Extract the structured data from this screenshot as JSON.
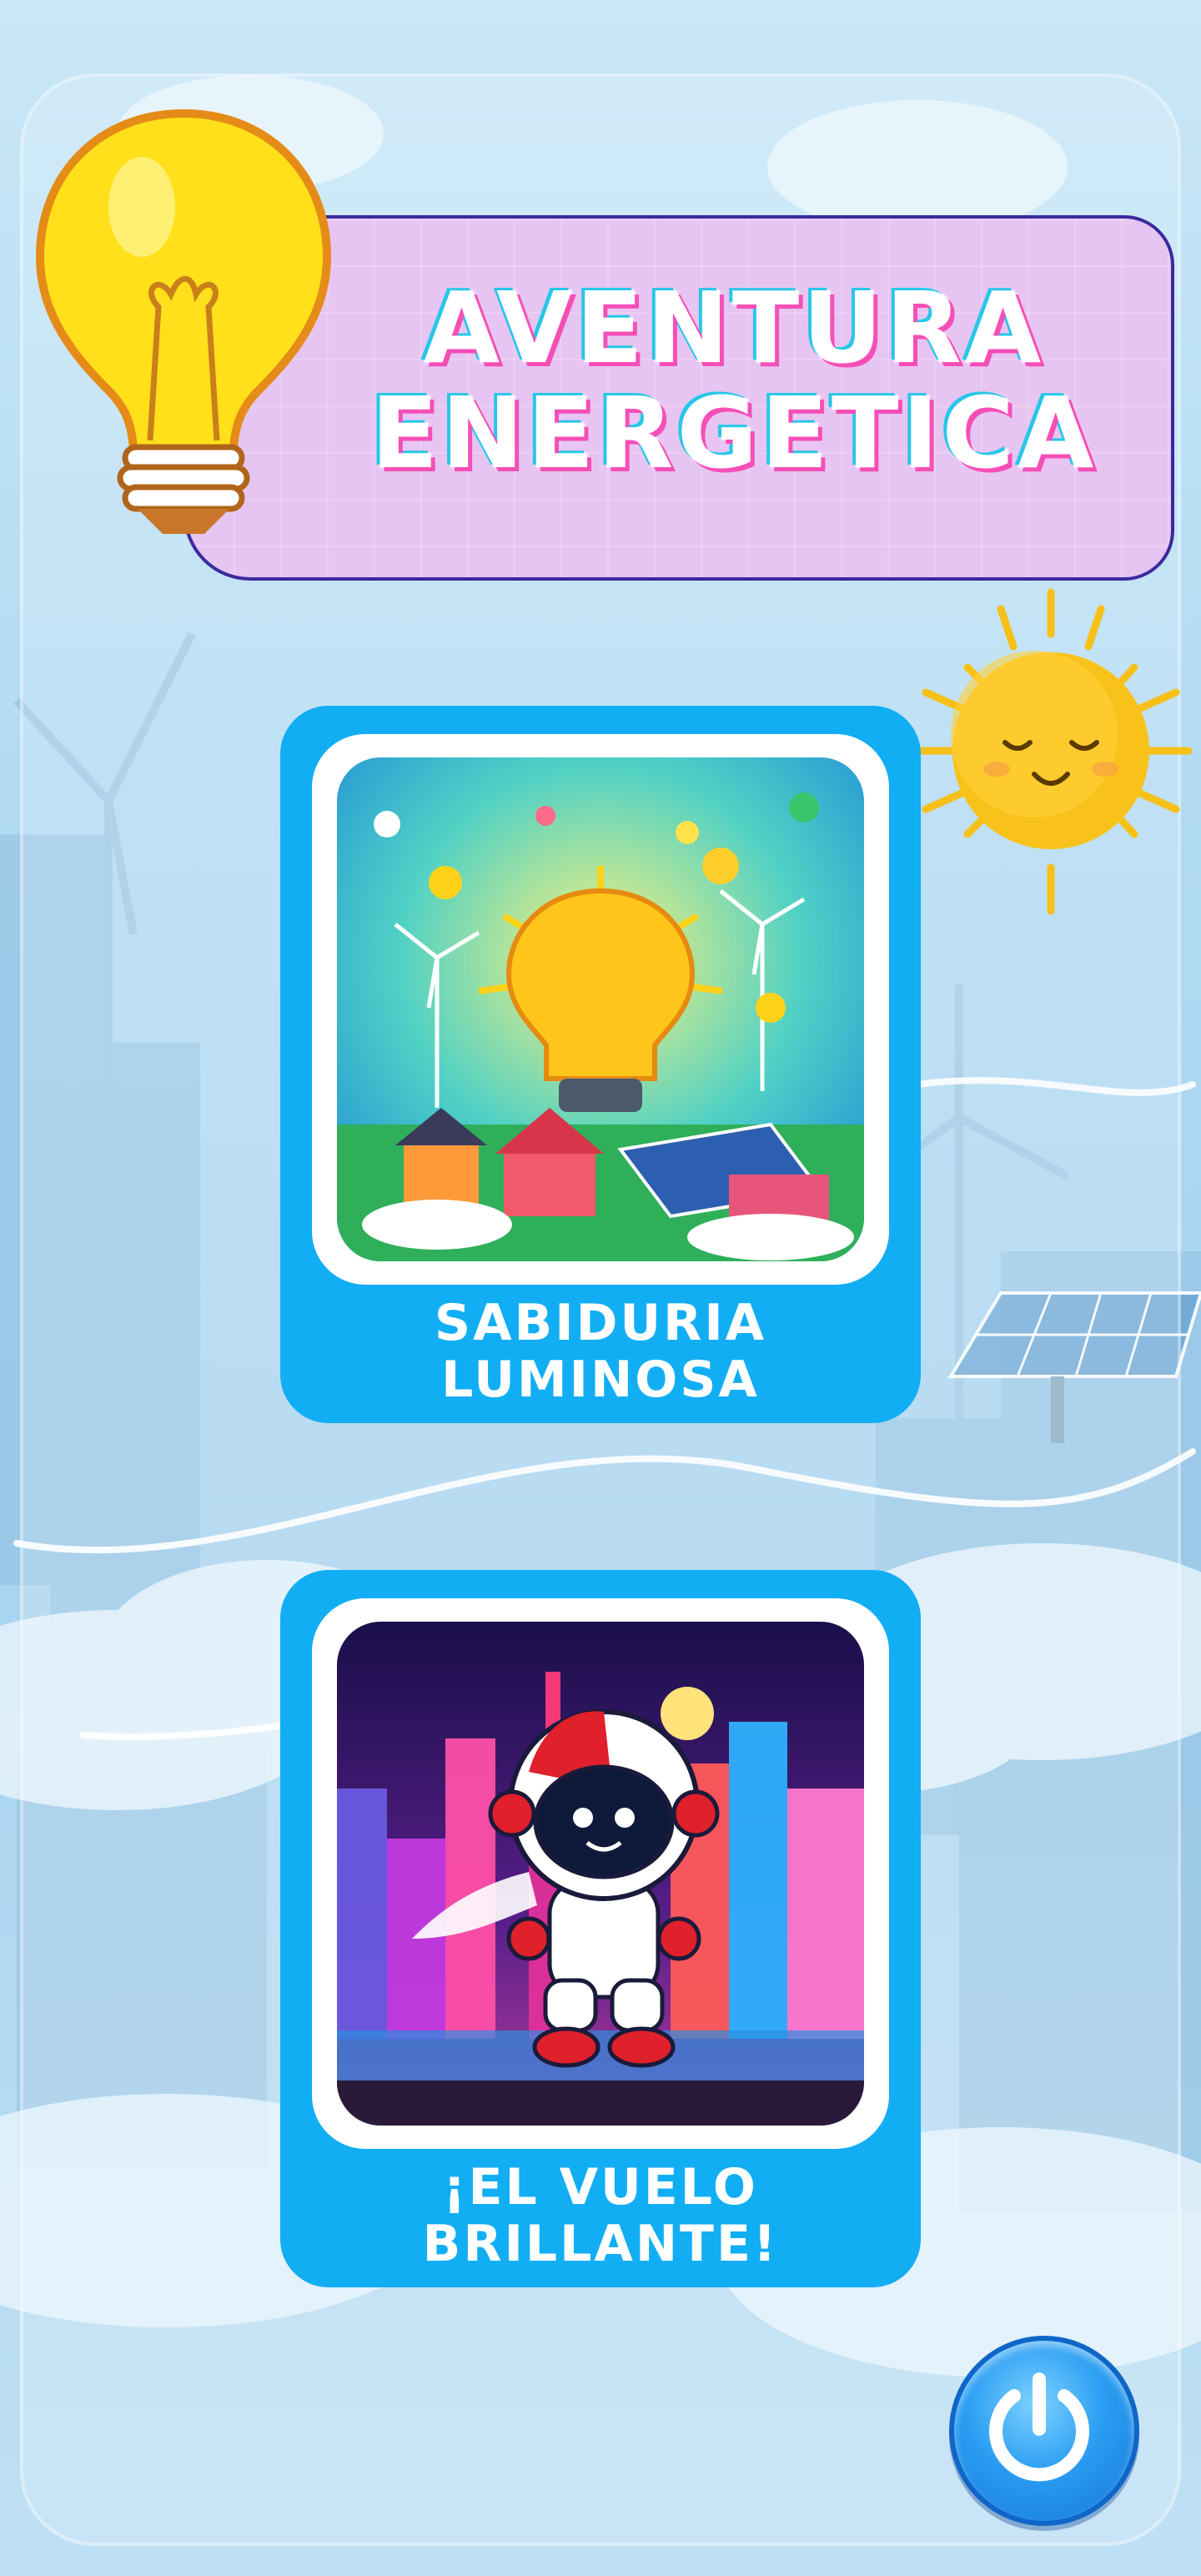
{
  "header": {
    "title_line1": "AVENTURA",
    "title_line2": "ENERGETICA",
    "logo_icon": "lightbulb-icon"
  },
  "decorations": {
    "sun_icon": "smiling-sun-icon",
    "background": "wind-turbines-solar-panels-city-clouds"
  },
  "games": [
    {
      "label_line1": "SABIDURIA",
      "label_line2": "LUMINOSA",
      "image": "energy-lightbulb-illustration"
    },
    {
      "label_line1": "¡EL VUELO",
      "label_line2": "BRILLANTE!",
      "image": "astronaut-city-illustration"
    }
  ],
  "controls": {
    "power_icon": "power-icon"
  },
  "colors": {
    "card_blue": "#12aef4",
    "title_panel": "#e7c5f2",
    "title_shadow_pink": "#f54fb7",
    "title_shadow_cyan": "#27c7e8",
    "sun": "#f9c21a"
  }
}
